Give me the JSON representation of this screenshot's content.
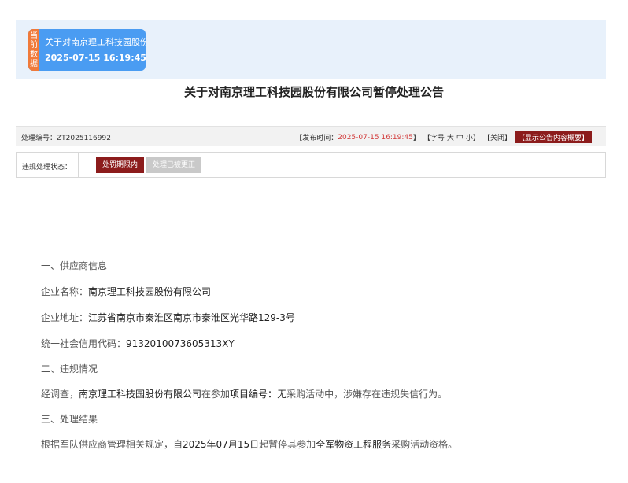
{
  "badge": {
    "side_chars": [
      "当",
      "前",
      "数",
      "据"
    ],
    "title": "关于对南京理工科技园股份",
    "time": "2025-07-15 16:19:45"
  },
  "page_title": "关于对南京理工科技园股份有限公司暂停处理公告",
  "info_bar": {
    "left_label": "处理编号：",
    "left_value": "ZT2025116992",
    "publish_open": "【发布时间：",
    "publish_time": "2025-07-15 16:19:45",
    "publish_close": "】",
    "font_size_open": "【字号",
    "font_large": "大",
    "font_medium": "中",
    "font_small": "小",
    "font_size_close": "】",
    "close_open": "【",
    "close_label": "关闭",
    "close_close": "】",
    "highlight_label": "【显示公告内容概要】"
  },
  "status": {
    "label": "违规处理状态：",
    "active_tag": "处罚期限内",
    "inactive_tag": "处理已被更正"
  },
  "content": {
    "section1_heading": "一、供应商信息",
    "company_name_label": "企业名称：",
    "company_name_value": "南京理工科技园股份有限公司",
    "company_address_label": "企业地址：",
    "company_address_value": "江苏省南京市秦淮区南京市秦淮区光华路129-3号",
    "credit_code_label": "统一社会信用代码：",
    "credit_code_value": "9132010073605313XY",
    "section2_heading": "二、违规情况",
    "violation_prefix": "经调查，",
    "violation_company": "南京理工科技园股份有限公司",
    "violation_mid": "在参加",
    "violation_project_label": "项目编号：",
    "violation_project_value": "无",
    "violation_suffix": "采购活动中，涉嫌存在违规失信行为。",
    "section3_heading": "三、处理结果",
    "result_prefix": "根据军队供应商管理相关规定，自",
    "result_date": "2025年07月15日",
    "result_mid": "起暂停其参加",
    "result_scope": "全军物资工程服务",
    "result_suffix": "采购活动资格。"
  }
}
